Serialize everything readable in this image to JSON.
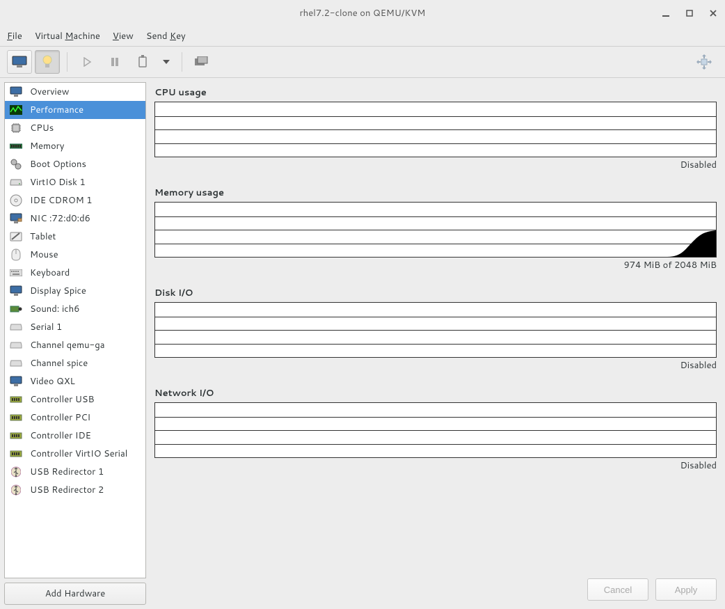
{
  "window": {
    "title": "rhel7.2-clone on QEMU/KVM"
  },
  "menu": {
    "file": "File",
    "vm": "Virtual Machine",
    "view": "View",
    "sendkey": "Send Key"
  },
  "sidebar": {
    "items": [
      {
        "icon": "monitor-icon",
        "label": "Overview"
      },
      {
        "icon": "performance-icon",
        "label": "Performance"
      },
      {
        "icon": "cpu-icon",
        "label": "CPUs"
      },
      {
        "icon": "memory-icon",
        "label": "Memory"
      },
      {
        "icon": "gears-icon",
        "label": "Boot Options"
      },
      {
        "icon": "disk-icon",
        "label": "VirtIO Disk 1"
      },
      {
        "icon": "cdrom-icon",
        "label": "IDE CDROM 1"
      },
      {
        "icon": "nic-icon",
        "label": "NIC :72:d0:d6"
      },
      {
        "icon": "tablet-icon",
        "label": "Tablet"
      },
      {
        "icon": "mouse-icon",
        "label": "Mouse"
      },
      {
        "icon": "keyboard-icon",
        "label": "Keyboard"
      },
      {
        "icon": "display-icon",
        "label": "Display Spice"
      },
      {
        "icon": "sound-icon",
        "label": "Sound: ich6"
      },
      {
        "icon": "serial-icon",
        "label": "Serial 1"
      },
      {
        "icon": "serial-icon",
        "label": "Channel qemu-ga"
      },
      {
        "icon": "serial-icon",
        "label": "Channel spice"
      },
      {
        "icon": "video-icon",
        "label": "Video QXL"
      },
      {
        "icon": "controller-icon",
        "label": "Controller USB"
      },
      {
        "icon": "controller-icon",
        "label": "Controller PCI"
      },
      {
        "icon": "controller-icon",
        "label": "Controller IDE"
      },
      {
        "icon": "controller-icon",
        "label": "Controller VirtIO Serial"
      },
      {
        "icon": "usb-icon",
        "label": "USB Redirector 1"
      },
      {
        "icon": "usb-icon",
        "label": "USB Redirector 2"
      }
    ],
    "selected_index": 1,
    "add_hardware": "Add Hardware"
  },
  "metrics": {
    "cpu": {
      "title": "CPU usage",
      "status": "Disabled"
    },
    "memory": {
      "title": "Memory usage",
      "status": "974 MiB of 2048 MiB"
    },
    "disk": {
      "title": "Disk I/O",
      "status": "Disabled"
    },
    "network": {
      "title": "Network I/O",
      "status": "Disabled"
    }
  },
  "chart_data": [
    {
      "type": "area",
      "title": "CPU usage",
      "values": [],
      "status": "Disabled"
    },
    {
      "type": "area",
      "title": "Memory usage",
      "used_mib": 974,
      "total_mib": 2048,
      "ylim": [
        0,
        2048
      ]
    },
    {
      "type": "area",
      "title": "Disk I/O",
      "values": [],
      "status": "Disabled"
    },
    {
      "type": "area",
      "title": "Network I/O",
      "values": [],
      "status": "Disabled"
    }
  ],
  "footer": {
    "cancel": "Cancel",
    "apply": "Apply"
  }
}
